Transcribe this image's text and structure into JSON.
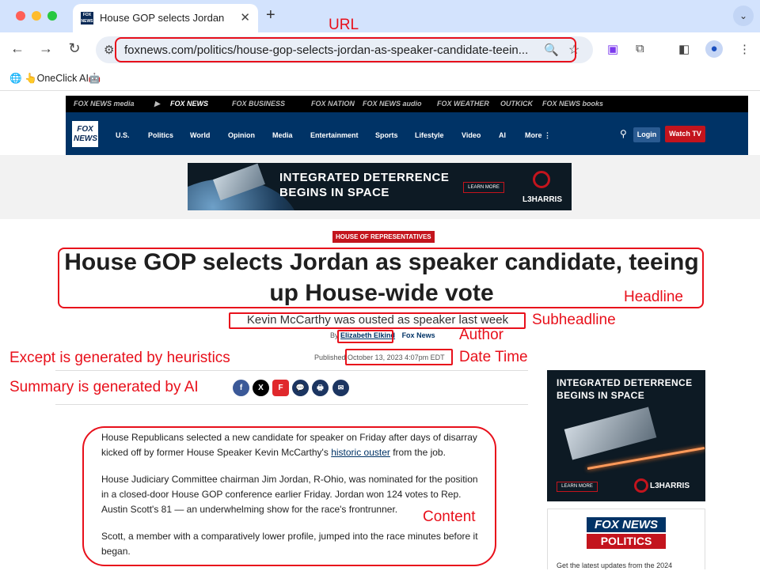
{
  "browser": {
    "tab_title": "House GOP selects Jordan as speaker candidate, teeing up House-wide vote",
    "tab_favicon_text": "FOX NEWS",
    "url": "foxnews.com/politics/house-gop-selects-jordan-as-speaker-candidate-teein...",
    "bookmark": "👆OneClick AI🤖"
  },
  "fox": {
    "strip": [
      "FOX NEWS media",
      "▶",
      "FOX NEWS",
      "FOX BUSINESS",
      "FOX NATION",
      "FOX NEWS audio",
      "FOX WEATHER",
      "OUTKICK",
      "FOX NEWS books"
    ],
    "logo": "FOX NEWS",
    "nav": [
      "U.S.",
      "Politics",
      "World",
      "Opinion",
      "Media",
      "Entertainment",
      "Sports",
      "Lifestyle",
      "Video",
      "AI",
      "More ⋮"
    ],
    "login": "Login",
    "watch_tv": "Watch TV"
  },
  "banner_ad": {
    "line1": "INTEGRATED DETERRENCE",
    "line2": "BEGINS IN SPACE",
    "cta": "LEARN MORE",
    "brand": "L3HARRIS"
  },
  "article": {
    "section": "HOUSE OF REPRESENTATIVES",
    "headline": "House GOP selects Jordan as speaker candidate, teeing up House-wide vote",
    "subheadline": "Kevin McCarthy was ousted as speaker last week",
    "by": "By",
    "author": "Elizabeth Elkind",
    "outlet": "Fox News",
    "published_label": "Published",
    "datetime": "October 13, 2023 4:07pm EDT",
    "share": [
      "f",
      "X",
      "F",
      "💬",
      "🖶",
      "✉"
    ],
    "p1_a": "House Republicans selected a new candidate for speaker on Friday after days of disarray kicked off by former House Speaker Kevin McCarthy's ",
    "p1_link": "historic ouster",
    "p1_b": " from the job.",
    "p2": "House Judiciary Committee chairman Jim Jordan, R-Ohio, was nominated for the position in a closed-door House GOP conference earlier Friday. Jordan won 124 votes to Rep. Austin Scott's 81 — an underwhelming show for the race's frontrunner.",
    "p3": "Scott, a member with a comparatively lower profile, jumped into the race minutes before it began."
  },
  "side_ad": {
    "line1": "INTEGRATED DETERRENCE",
    "line2": "BEGINS IN SPACE",
    "cta": "LEARN MORE",
    "brand": "L3HARRIS"
  },
  "politics_box": {
    "logo_top": "FOX NEWS",
    "logo_bottom": "POLITICS",
    "text": "Get the latest updates from the 2024"
  },
  "annotations": {
    "url": "URL",
    "headline": "Headline",
    "subheadline": "Subheadline",
    "author": "Author",
    "datetime": "Date Time",
    "excerpt_note": "Except is generated by heuristics",
    "summary_note": "Summary is generated by AI",
    "content": "Content"
  },
  "colors": {
    "annotation": "#e8101b",
    "fox_navy": "#003366",
    "fox_red": "#c3141d"
  }
}
